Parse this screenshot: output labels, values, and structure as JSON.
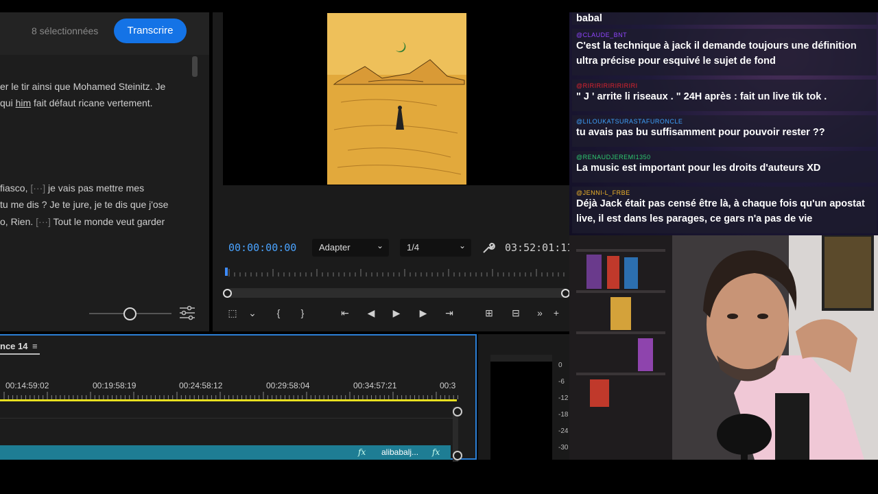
{
  "transcript": {
    "selected_count": "8 sélectionnées",
    "transcribe_label": "Transcrire",
    "lines": [
      {
        "pre": "er le tir ainsi que Mohamed Steinitz. Je",
        "dim": "",
        "post": ""
      },
      {
        "pre": "qui ",
        "u": "him",
        "post": " fait défaut ricane vertement."
      },
      {
        "pre": " fiasco, ",
        "dim": "[···]",
        "post": " je vais pas mettre mes"
      },
      {
        "pre": "tu me dis ? Je te jure, je te dis que j'ose",
        "dim": "",
        "post": ""
      },
      {
        "pre": "o, Rien. ",
        "dim": "[···]",
        "post": " Tout le monde veut garder"
      }
    ]
  },
  "program": {
    "timecode": "00:00:00:00",
    "fit_select": "Adapter",
    "resolution_select": "1/4",
    "duration": "03:52:01:11"
  },
  "timeline": {
    "sequence_label": "nce 14",
    "timecodes": [
      "00:14:59:02",
      "00:19:58:19",
      "00:24:58:12",
      "00:29:58:04",
      "00:34:57:21",
      "00:3"
    ],
    "clip_name": "alibabalj...",
    "fx": "fx"
  },
  "meter": {
    "db_labels": [
      "0",
      "-6",
      "-12",
      "-18",
      "-24",
      "-30"
    ]
  },
  "chat": {
    "messages": [
      {
        "user": "",
        "text": "babal",
        "color": "#fff"
      },
      {
        "user": "@CLAUDE_BNT",
        "text": "C'est la technique à jack il demande toujours une définition ultra précise pour esquivé le sujet de fond",
        "color": "#9146ff"
      },
      {
        "user": "@RIRIRIRIRIRIRIRI",
        "text": "\" J ' arrite li riseaux . \" 24H après : fait un live tik tok .",
        "color": "#e0242e"
      },
      {
        "user": "@LILOUKATSURASTAFURONCLE",
        "text": "tu avais pas bu suffisamment pour pouvoir rester ??",
        "color": "#3fa3ff"
      },
      {
        "user": "@RENAUDJEREMI1350",
        "text": "La music est important pour les droits d'auteurs XD",
        "color": "#2ecc71"
      },
      {
        "user": "@JENNI-L_FRBE",
        "text": "Déjà Jack était pas censé être là, à chaque fois qu'un apostat live, il est dans les parages, ce gars n'a pas de vie",
        "color": "#f0b429"
      }
    ]
  }
}
